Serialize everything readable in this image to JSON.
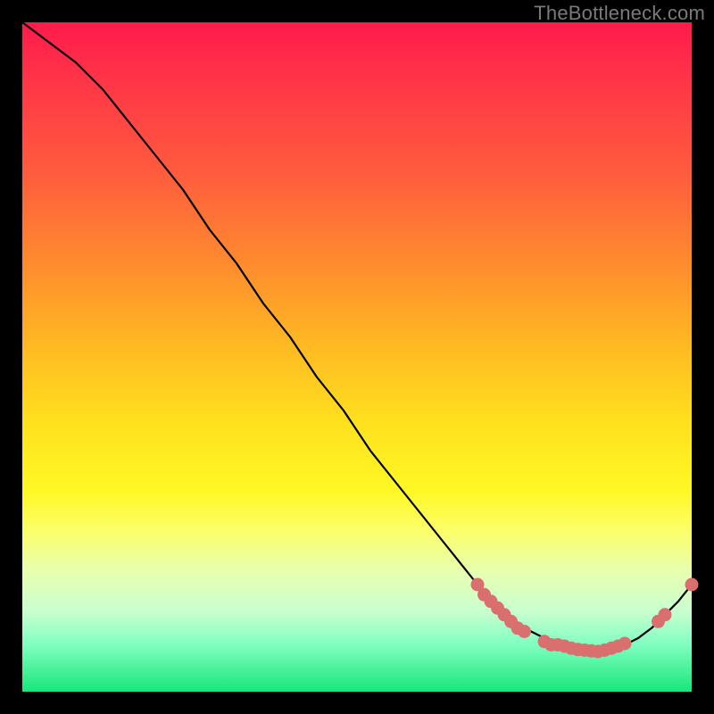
{
  "watermark": "TheBottleneck.com",
  "chart_data": {
    "type": "line",
    "title": "",
    "xlabel": "",
    "ylabel": "",
    "xlim": [
      0,
      100
    ],
    "ylim": [
      0,
      100
    ],
    "grid": false,
    "legend": false,
    "series": [
      {
        "name": "curve",
        "x": [
          0,
          4,
          8,
          12,
          16,
          20,
          24,
          28,
          32,
          36,
          40,
          44,
          48,
          52,
          56,
          60,
          64,
          68,
          70,
          72,
          74,
          76,
          78,
          80,
          82,
          84,
          86,
          88,
          90,
          92,
          94,
          96,
          98,
          100
        ],
        "y": [
          100,
          97,
          94,
          90,
          85,
          80,
          75,
          69,
          64,
          58,
          53,
          47,
          42,
          36,
          31,
          26,
          21,
          16,
          14,
          12,
          10,
          9,
          8,
          7,
          6.5,
          6,
          6,
          6.5,
          7,
          8,
          9.5,
          11.5,
          13.5,
          16
        ]
      }
    ],
    "markers": [
      {
        "x": 68.0,
        "y": 16.0
      },
      {
        "x": 69.0,
        "y": 14.5
      },
      {
        "x": 70.0,
        "y": 13.5
      },
      {
        "x": 71.0,
        "y": 12.5
      },
      {
        "x": 72.0,
        "y": 11.5
      },
      {
        "x": 73.0,
        "y": 10.5
      },
      {
        "x": 74.0,
        "y": 9.5
      },
      {
        "x": 75.0,
        "y": 9.0
      },
      {
        "x": 78.0,
        "y": 7.5
      },
      {
        "x": 79.0,
        "y": 7.0
      },
      {
        "x": 80.0,
        "y": 7.0
      },
      {
        "x": 81.0,
        "y": 6.8
      },
      {
        "x": 82.0,
        "y": 6.5
      },
      {
        "x": 83.0,
        "y": 6.3
      },
      {
        "x": 84.0,
        "y": 6.2
      },
      {
        "x": 85.0,
        "y": 6.1
      },
      {
        "x": 86.0,
        "y": 6.0
      },
      {
        "x": 87.0,
        "y": 6.2
      },
      {
        "x": 88.0,
        "y": 6.5
      },
      {
        "x": 89.0,
        "y": 6.8
      },
      {
        "x": 90.0,
        "y": 7.2
      },
      {
        "x": 95.0,
        "y": 10.5
      },
      {
        "x": 96.0,
        "y": 11.5
      },
      {
        "x": 100.0,
        "y": 16.0
      }
    ],
    "marker_color": "#d9706f",
    "line_color": "#000000"
  }
}
